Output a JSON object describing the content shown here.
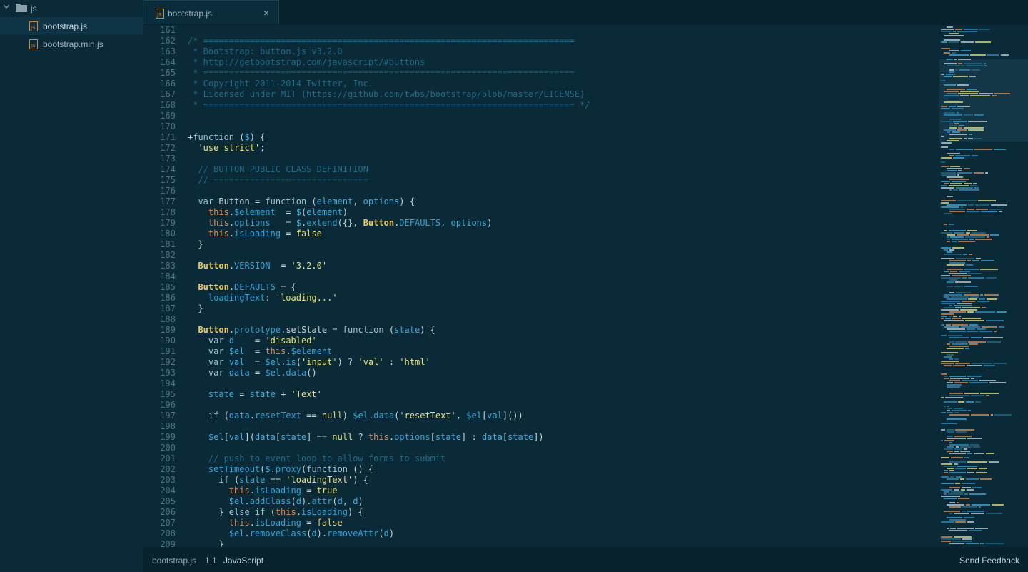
{
  "sidebar": {
    "folder": {
      "name": "js",
      "icon": "folder-icon"
    },
    "files": [
      {
        "name": "bootstrap.js",
        "selected": true,
        "icon": "js-file-icon"
      },
      {
        "name": "bootstrap.min.js",
        "selected": false,
        "icon": "js-file-icon"
      }
    ]
  },
  "tab": {
    "title": "bootstrap.js",
    "close_label": "×"
  },
  "editor": {
    "lines": [
      {
        "n": "161",
        "t": []
      },
      {
        "n": "162",
        "t": [
          [
            "cm",
            "/* ========================================================================"
          ]
        ]
      },
      {
        "n": "163",
        "t": [
          [
            "cm",
            " * Bootstrap: button.js v3.2.0"
          ]
        ]
      },
      {
        "n": "164",
        "t": [
          [
            "cm",
            " * http://getbootstrap.com/javascript/#buttons"
          ]
        ]
      },
      {
        "n": "165",
        "t": [
          [
            "cm",
            " * ========================================================================"
          ]
        ]
      },
      {
        "n": "166",
        "t": [
          [
            "cm",
            " * Copyright 2011-2014 Twitter, Inc."
          ]
        ]
      },
      {
        "n": "167",
        "t": [
          [
            "cm",
            " * Licensed under MIT (https://github.com/twbs/bootstrap/blob/master/LICENSE)"
          ]
        ]
      },
      {
        "n": "168",
        "t": [
          [
            "cm",
            " * ======================================================================== */"
          ]
        ]
      },
      {
        "n": "169",
        "t": []
      },
      {
        "n": "170",
        "t": []
      },
      {
        "n": "171",
        "t": [
          [
            "op",
            "+"
          ],
          [
            "kw",
            "function"
          ],
          [
            "op",
            " ("
          ],
          [
            "var",
            "$"
          ],
          [
            "op",
            ") {"
          ]
        ]
      },
      {
        "n": "172",
        "t": [
          [
            "op",
            "  "
          ],
          [
            "str",
            "'use strict'"
          ],
          [
            "op",
            ";"
          ]
        ]
      },
      {
        "n": "173",
        "t": []
      },
      {
        "n": "174",
        "t": [
          [
            "cm",
            "  // BUTTON PUBLIC CLASS DEFINITION"
          ]
        ]
      },
      {
        "n": "175",
        "t": [
          [
            "cm",
            "  // =============================="
          ]
        ]
      },
      {
        "n": "176",
        "t": []
      },
      {
        "n": "177",
        "t": [
          [
            "op",
            "  "
          ],
          [
            "kw",
            "var"
          ],
          [
            "op",
            " Button = "
          ],
          [
            "kw",
            "function"
          ],
          [
            "op",
            " ("
          ],
          [
            "var",
            "element"
          ],
          [
            "op",
            ", "
          ],
          [
            "var",
            "options"
          ],
          [
            "op",
            ") {"
          ]
        ]
      },
      {
        "n": "178",
        "t": [
          [
            "op",
            "    "
          ],
          [
            "this",
            "this"
          ],
          [
            "op",
            "."
          ],
          [
            "prop",
            "$element"
          ],
          [
            "op",
            "  = "
          ],
          [
            "var",
            "$"
          ],
          [
            "op",
            "("
          ],
          [
            "var",
            "element"
          ],
          [
            "op",
            ")"
          ]
        ]
      },
      {
        "n": "179",
        "t": [
          [
            "op",
            "    "
          ],
          [
            "this",
            "this"
          ],
          [
            "op",
            "."
          ],
          [
            "prop",
            "options"
          ],
          [
            "op",
            "   = "
          ],
          [
            "var",
            "$"
          ],
          [
            "op",
            "."
          ],
          [
            "prop",
            "extend"
          ],
          [
            "op",
            "({}, "
          ],
          [
            "cls",
            "Button"
          ],
          [
            "op",
            "."
          ],
          [
            "prop",
            "DEFAULTS"
          ],
          [
            "op",
            ", "
          ],
          [
            "var",
            "options"
          ],
          [
            "op",
            ")"
          ]
        ]
      },
      {
        "n": "180",
        "t": [
          [
            "op",
            "    "
          ],
          [
            "this",
            "this"
          ],
          [
            "op",
            "."
          ],
          [
            "prop",
            "isLoading"
          ],
          [
            "op",
            " = "
          ],
          [
            "lit",
            "false"
          ]
        ]
      },
      {
        "n": "181",
        "t": [
          [
            "op",
            "  }"
          ]
        ]
      },
      {
        "n": "182",
        "t": []
      },
      {
        "n": "183",
        "t": [
          [
            "op",
            "  "
          ],
          [
            "cls",
            "Button"
          ],
          [
            "op",
            "."
          ],
          [
            "prop",
            "VERSION"
          ],
          [
            "op",
            "  = "
          ],
          [
            "str",
            "'3.2.0'"
          ]
        ]
      },
      {
        "n": "184",
        "t": []
      },
      {
        "n": "185",
        "t": [
          [
            "op",
            "  "
          ],
          [
            "cls",
            "Button"
          ],
          [
            "op",
            "."
          ],
          [
            "prop",
            "DEFAULTS"
          ],
          [
            "op",
            " = {"
          ]
        ]
      },
      {
        "n": "186",
        "t": [
          [
            "op",
            "    "
          ],
          [
            "prop",
            "loadingText"
          ],
          [
            "op",
            ": "
          ],
          [
            "str",
            "'loading...'"
          ]
        ]
      },
      {
        "n": "187",
        "t": [
          [
            "op",
            "  }"
          ]
        ]
      },
      {
        "n": "188",
        "t": []
      },
      {
        "n": "189",
        "t": [
          [
            "op",
            "  "
          ],
          [
            "cls",
            "Button"
          ],
          [
            "op",
            "."
          ],
          [
            "prop",
            "prototype"
          ],
          [
            "op",
            "."
          ],
          [
            "fn",
            "setState"
          ],
          [
            "op",
            " = "
          ],
          [
            "kw",
            "function"
          ],
          [
            "op",
            " ("
          ],
          [
            "var",
            "state"
          ],
          [
            "op",
            ") {"
          ]
        ]
      },
      {
        "n": "190",
        "t": [
          [
            "op",
            "    "
          ],
          [
            "kw",
            "var"
          ],
          [
            "op",
            " "
          ],
          [
            "var",
            "d"
          ],
          [
            "op",
            "    = "
          ],
          [
            "str",
            "'disabled'"
          ]
        ]
      },
      {
        "n": "191",
        "t": [
          [
            "op",
            "    "
          ],
          [
            "kw",
            "var"
          ],
          [
            "op",
            " "
          ],
          [
            "var",
            "$el"
          ],
          [
            "op",
            "  = "
          ],
          [
            "this",
            "this"
          ],
          [
            "op",
            "."
          ],
          [
            "prop",
            "$element"
          ]
        ]
      },
      {
        "n": "192",
        "t": [
          [
            "op",
            "    "
          ],
          [
            "kw",
            "var"
          ],
          [
            "op",
            " "
          ],
          [
            "var",
            "val"
          ],
          [
            "op",
            "  = "
          ],
          [
            "var",
            "$el"
          ],
          [
            "op",
            "."
          ],
          [
            "prop",
            "is"
          ],
          [
            "op",
            "("
          ],
          [
            "str",
            "'input'"
          ],
          [
            "op",
            ") ? "
          ],
          [
            "str",
            "'val'"
          ],
          [
            "op",
            " : "
          ],
          [
            "str",
            "'html'"
          ]
        ]
      },
      {
        "n": "193",
        "t": [
          [
            "op",
            "    "
          ],
          [
            "kw",
            "var"
          ],
          [
            "op",
            " "
          ],
          [
            "var",
            "data"
          ],
          [
            "op",
            " = "
          ],
          [
            "var",
            "$el"
          ],
          [
            "op",
            "."
          ],
          [
            "prop",
            "data"
          ],
          [
            "op",
            "()"
          ]
        ]
      },
      {
        "n": "194",
        "t": []
      },
      {
        "n": "195",
        "t": [
          [
            "op",
            "    "
          ],
          [
            "var",
            "state"
          ],
          [
            "op",
            " = "
          ],
          [
            "var",
            "state"
          ],
          [
            "op",
            " + "
          ],
          [
            "str",
            "'Text'"
          ]
        ]
      },
      {
        "n": "196",
        "t": []
      },
      {
        "n": "197",
        "t": [
          [
            "op",
            "    "
          ],
          [
            "kw",
            "if"
          ],
          [
            "op",
            " ("
          ],
          [
            "var",
            "data"
          ],
          [
            "op",
            "."
          ],
          [
            "prop",
            "resetText"
          ],
          [
            "op",
            " == "
          ],
          [
            "lit",
            "null"
          ],
          [
            "op",
            ") "
          ],
          [
            "var",
            "$el"
          ],
          [
            "op",
            "."
          ],
          [
            "prop",
            "data"
          ],
          [
            "op",
            "("
          ],
          [
            "str",
            "'resetText'"
          ],
          [
            "op",
            ", "
          ],
          [
            "var",
            "$el"
          ],
          [
            "op",
            "["
          ],
          [
            "var",
            "val"
          ],
          [
            "op",
            "]())"
          ]
        ]
      },
      {
        "n": "198",
        "t": []
      },
      {
        "n": "199",
        "t": [
          [
            "op",
            "    "
          ],
          [
            "var",
            "$el"
          ],
          [
            "op",
            "["
          ],
          [
            "var",
            "val"
          ],
          [
            "op",
            "]("
          ],
          [
            "var",
            "data"
          ],
          [
            "op",
            "["
          ],
          [
            "var",
            "state"
          ],
          [
            "op",
            "] == "
          ],
          [
            "lit",
            "null"
          ],
          [
            "op",
            " ? "
          ],
          [
            "this",
            "this"
          ],
          [
            "op",
            "."
          ],
          [
            "prop",
            "options"
          ],
          [
            "op",
            "["
          ],
          [
            "var",
            "state"
          ],
          [
            "op",
            "] : "
          ],
          [
            "var",
            "data"
          ],
          [
            "op",
            "["
          ],
          [
            "var",
            "state"
          ],
          [
            "op",
            "])"
          ]
        ]
      },
      {
        "n": "200",
        "t": []
      },
      {
        "n": "201",
        "t": [
          [
            "cm",
            "    // push to event loop to allow forms to submit"
          ]
        ]
      },
      {
        "n": "202",
        "t": [
          [
            "op",
            "    "
          ],
          [
            "prop",
            "setTimeout"
          ],
          [
            "op",
            "("
          ],
          [
            "var",
            "$"
          ],
          [
            "op",
            "."
          ],
          [
            "prop",
            "proxy"
          ],
          [
            "op",
            "("
          ],
          [
            "kw",
            "function"
          ],
          [
            "op",
            " () {"
          ]
        ]
      },
      {
        "n": "203",
        "t": [
          [
            "op",
            "      "
          ],
          [
            "kw",
            "if"
          ],
          [
            "op",
            " ("
          ],
          [
            "var",
            "state"
          ],
          [
            "op",
            " == "
          ],
          [
            "str",
            "'loadingText'"
          ],
          [
            "op",
            ") {"
          ]
        ]
      },
      {
        "n": "204",
        "t": [
          [
            "op",
            "        "
          ],
          [
            "this",
            "this"
          ],
          [
            "op",
            "."
          ],
          [
            "prop",
            "isLoading"
          ],
          [
            "op",
            " = "
          ],
          [
            "lit",
            "true"
          ]
        ]
      },
      {
        "n": "205",
        "t": [
          [
            "op",
            "        "
          ],
          [
            "var",
            "$el"
          ],
          [
            "op",
            "."
          ],
          [
            "prop",
            "addClass"
          ],
          [
            "op",
            "("
          ],
          [
            "var",
            "d"
          ],
          [
            "op",
            ")."
          ],
          [
            "prop",
            "attr"
          ],
          [
            "op",
            "("
          ],
          [
            "var",
            "d"
          ],
          [
            "op",
            ", "
          ],
          [
            "var",
            "d"
          ],
          [
            "op",
            ")"
          ]
        ]
      },
      {
        "n": "206",
        "t": [
          [
            "op",
            "      } "
          ],
          [
            "kw",
            "else if"
          ],
          [
            "op",
            " ("
          ],
          [
            "this",
            "this"
          ],
          [
            "op",
            "."
          ],
          [
            "prop",
            "isLoading"
          ],
          [
            "op",
            ") {"
          ]
        ]
      },
      {
        "n": "207",
        "t": [
          [
            "op",
            "        "
          ],
          [
            "this",
            "this"
          ],
          [
            "op",
            "."
          ],
          [
            "prop",
            "isLoading"
          ],
          [
            "op",
            " = "
          ],
          [
            "lit",
            "false"
          ]
        ]
      },
      {
        "n": "208",
        "t": [
          [
            "op",
            "        "
          ],
          [
            "var",
            "$el"
          ],
          [
            "op",
            "."
          ],
          [
            "prop",
            "removeClass"
          ],
          [
            "op",
            "("
          ],
          [
            "var",
            "d"
          ],
          [
            "op",
            ")."
          ],
          [
            "prop",
            "removeAttr"
          ],
          [
            "op",
            "("
          ],
          [
            "var",
            "d"
          ],
          [
            "op",
            ")"
          ]
        ]
      },
      {
        "n": "209",
        "t": [
          [
            "op",
            "      }"
          ]
        ]
      }
    ]
  },
  "statusbar": {
    "file": "bootstrap.js",
    "position": "1,1",
    "language": "JavaScript",
    "feedback": "Send Feedback"
  },
  "colors": {
    "background": "#0a2a38",
    "comment": "#1f6b88",
    "string": "#e6e27a",
    "this_keyword": "#df8a4b",
    "class_name": "#f1c85a",
    "property": "#2fa4d9"
  }
}
